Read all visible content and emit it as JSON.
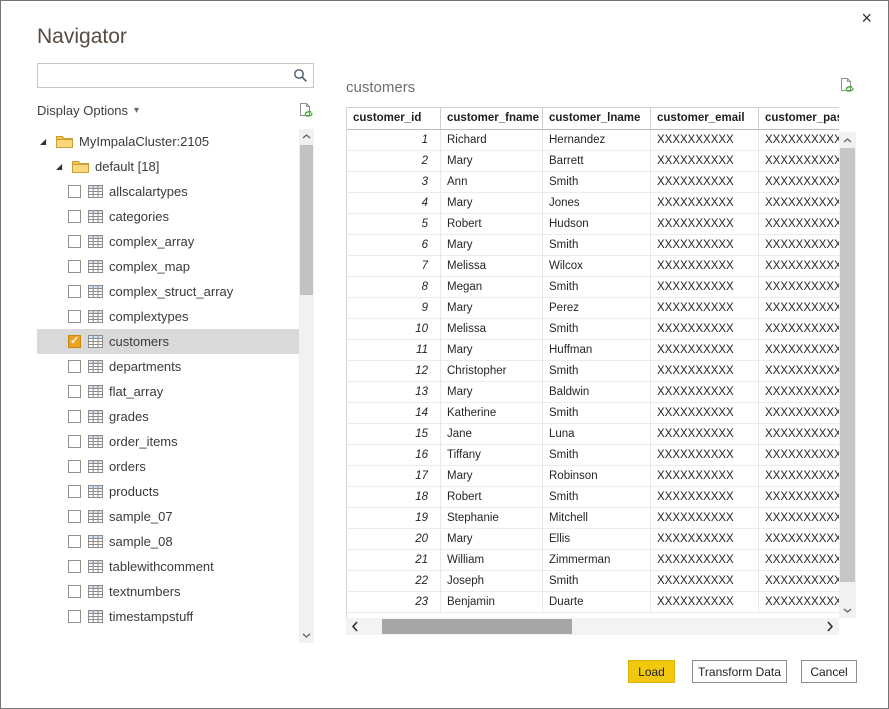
{
  "dialog": {
    "title": "Navigator"
  },
  "icons": {
    "close": "×",
    "caret": "▾",
    "expander": "◢",
    "check": "✓"
  },
  "left_panel": {
    "search": {
      "value": "",
      "placeholder": ""
    },
    "display_options": {
      "label": "Display Options"
    },
    "tree": {
      "root": {
        "label": "MyImpalaCluster:2105",
        "expanded": true
      },
      "database": {
        "label": "default [18]",
        "expanded": true
      },
      "items": [
        {
          "label": "allscalartypes",
          "checked": false,
          "selected": false
        },
        {
          "label": "categories",
          "checked": false,
          "selected": false
        },
        {
          "label": "complex_array",
          "checked": false,
          "selected": false
        },
        {
          "label": "complex_map",
          "checked": false,
          "selected": false
        },
        {
          "label": "complex_struct_array",
          "checked": false,
          "selected": false
        },
        {
          "label": "complextypes",
          "checked": false,
          "selected": false
        },
        {
          "label": "customers",
          "checked": true,
          "selected": true
        },
        {
          "label": "departments",
          "checked": false,
          "selected": false
        },
        {
          "label": "flat_array",
          "checked": false,
          "selected": false
        },
        {
          "label": "grades",
          "checked": false,
          "selected": false
        },
        {
          "label": "order_items",
          "checked": false,
          "selected": false
        },
        {
          "label": "orders",
          "checked": false,
          "selected": false
        },
        {
          "label": "products",
          "checked": false,
          "selected": false
        },
        {
          "label": "sample_07",
          "checked": false,
          "selected": false
        },
        {
          "label": "sample_08",
          "checked": false,
          "selected": false
        },
        {
          "label": "tablewithcomment",
          "checked": false,
          "selected": false
        },
        {
          "label": "textnumbers",
          "checked": false,
          "selected": false
        },
        {
          "label": "timestampstuff",
          "checked": false,
          "selected": false
        }
      ]
    }
  },
  "preview": {
    "title": "customers",
    "columns": [
      "customer_id",
      "customer_fname",
      "customer_lname",
      "customer_email",
      "customer_passw"
    ],
    "masked_value": "XXXXXXXXXX",
    "rows": [
      [
        "1",
        "Richard",
        "Hernandez",
        "XXXXXXXXXX",
        "XXXXXXXXXX"
      ],
      [
        "2",
        "Mary",
        "Barrett",
        "XXXXXXXXXX",
        "XXXXXXXXXX"
      ],
      [
        "3",
        "Ann",
        "Smith",
        "XXXXXXXXXX",
        "XXXXXXXXXX"
      ],
      [
        "4",
        "Mary",
        "Jones",
        "XXXXXXXXXX",
        "XXXXXXXXXX"
      ],
      [
        "5",
        "Robert",
        "Hudson",
        "XXXXXXXXXX",
        "XXXXXXXXXX"
      ],
      [
        "6",
        "Mary",
        "Smith",
        "XXXXXXXXXX",
        "XXXXXXXXXX"
      ],
      [
        "7",
        "Melissa",
        "Wilcox",
        "XXXXXXXXXX",
        "XXXXXXXXXX"
      ],
      [
        "8",
        "Megan",
        "Smith",
        "XXXXXXXXXX",
        "XXXXXXXXXX"
      ],
      [
        "9",
        "Mary",
        "Perez",
        "XXXXXXXXXX",
        "XXXXXXXXXX"
      ],
      [
        "10",
        "Melissa",
        "Smith",
        "XXXXXXXXXX",
        "XXXXXXXXXX"
      ],
      [
        "11",
        "Mary",
        "Huffman",
        "XXXXXXXXXX",
        "XXXXXXXXXX"
      ],
      [
        "12",
        "Christopher",
        "Smith",
        "XXXXXXXXXX",
        "XXXXXXXXXX"
      ],
      [
        "13",
        "Mary",
        "Baldwin",
        "XXXXXXXXXX",
        "XXXXXXXXXX"
      ],
      [
        "14",
        "Katherine",
        "Smith",
        "XXXXXXXXXX",
        "XXXXXXXXXX"
      ],
      [
        "15",
        "Jane",
        "Luna",
        "XXXXXXXXXX",
        "XXXXXXXXXX"
      ],
      [
        "16",
        "Tiffany",
        "Smith",
        "XXXXXXXXXX",
        "XXXXXXXXXX"
      ],
      [
        "17",
        "Mary",
        "Robinson",
        "XXXXXXXXXX",
        "XXXXXXXXXX"
      ],
      [
        "18",
        "Robert",
        "Smith",
        "XXXXXXXXXX",
        "XXXXXXXXXX"
      ],
      [
        "19",
        "Stephanie",
        "Mitchell",
        "XXXXXXXXXX",
        "XXXXXXXXXX"
      ],
      [
        "20",
        "Mary",
        "Ellis",
        "XXXXXXXXXX",
        "XXXXXXXXXX"
      ],
      [
        "21",
        "William",
        "Zimmerman",
        "XXXXXXXXXX",
        "XXXXXXXXXX"
      ],
      [
        "22",
        "Joseph",
        "Smith",
        "XXXXXXXXXX",
        "XXXXXXXXXX"
      ],
      [
        "23",
        "Benjamin",
        "Duarte",
        "XXXXXXXXXX",
        "XXXXXXXXXX"
      ]
    ]
  },
  "footer": {
    "load": "Load",
    "transform": "Transform Data",
    "cancel": "Cancel"
  },
  "colors": {
    "accent_gold": "#f2c80f",
    "checkbox_checked": "#eda21d",
    "selected_row_bg": "#d9d9d9",
    "title_text": "#564c42"
  }
}
